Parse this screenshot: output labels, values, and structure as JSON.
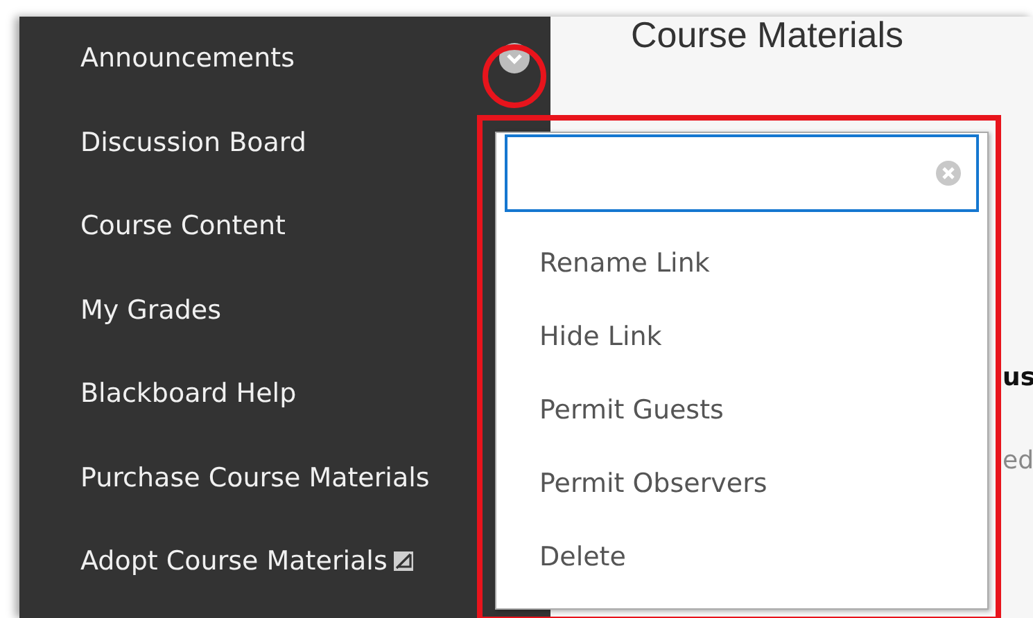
{
  "sidebar": {
    "items": [
      {
        "label": "Announcements",
        "kind": "menu"
      },
      {
        "label": "Discussion Board",
        "kind": "link"
      },
      {
        "label": "Course Content",
        "kind": "link"
      },
      {
        "label": "My Grades",
        "kind": "link"
      },
      {
        "label": "Blackboard Help",
        "kind": "link"
      },
      {
        "label": "Purchase Course Materials",
        "kind": "link"
      },
      {
        "label": "Adopt Course Materials",
        "kind": "external"
      }
    ]
  },
  "content": {
    "heading": "Course Materials",
    "fragments": [
      {
        "text": "us",
        "kind": "bold"
      },
      {
        "text": "ed",
        "kind": "plain"
      }
    ]
  },
  "context_menu": {
    "items": [
      "Rename Link",
      "Hide Link",
      "Permit Guests",
      "Permit Observers",
      "Delete"
    ]
  },
  "annotations": [
    {
      "kind": "circle",
      "color": "#e8141c"
    },
    {
      "kind": "rectangle",
      "color": "#e8141c"
    }
  ]
}
